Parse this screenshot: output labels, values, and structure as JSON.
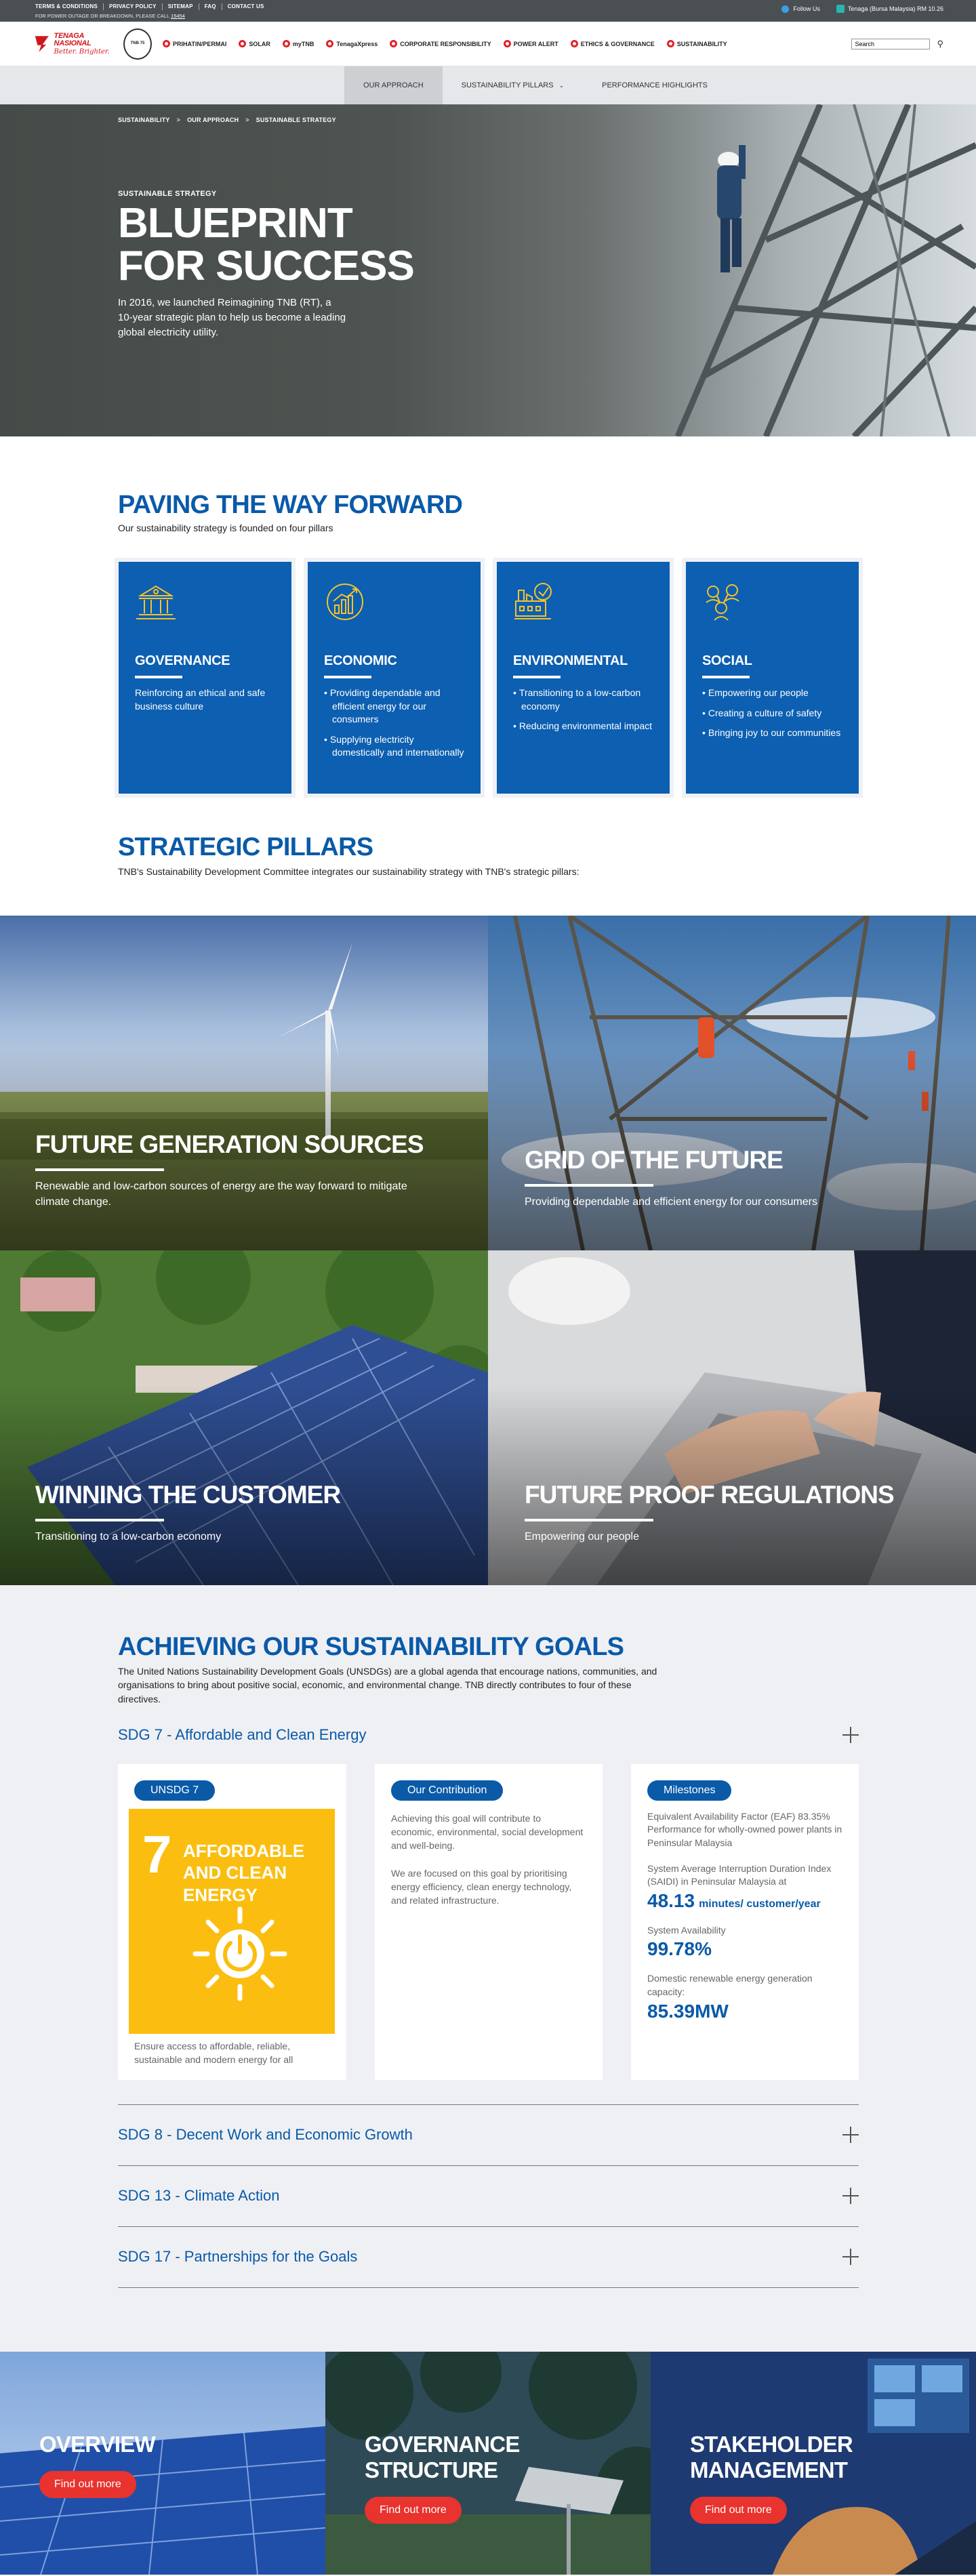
{
  "topbar": {
    "links": [
      "TERMS & CONDITIONS",
      "PRIVACY POLICY",
      "SITEMAP",
      "FAQ",
      "CONTACT US"
    ],
    "note_prefix": "FOR POWER OUTAGE OR BREAKDOWN, PLEASE CALL",
    "note_link": "15454",
    "follow": "Follow Us",
    "stock": "Tenaga (Bursa Malaysia) RM 10.26"
  },
  "header": {
    "logo_name": "TENAGA NASIONAL",
    "logo_tagline": "Better. Brighter.",
    "seal_text": "TNB 75",
    "nav": [
      "PRIHATIN/PERMAI",
      "SOLAR",
      "myTNB",
      "TenagaXpress",
      "CORPORATE RESPONSIBILITY",
      "POWER ALERT",
      "ETHICS & GOVERNANCE",
      "SUSTAINABILITY"
    ],
    "search_value": "Search",
    "search_icon": "search-icon"
  },
  "subnav": {
    "tabs": [
      "OUR APPROACH",
      "SUSTAINABILITY PILLARS",
      "PERFORMANCE HIGHLIGHTS"
    ]
  },
  "hero": {
    "crumbs": [
      "SUSTAINABILITY",
      "OUR APPROACH",
      "SUSTAINABLE STRATEGY"
    ],
    "kicker": "SUSTAINABLE STRATEGY",
    "title_line1": "BLUEPRINT",
    "title_line2": "FOR SUCCESS",
    "desc": "In 2016, we launched Reimagining TNB (RT), a 10-year strategic plan to help us become a leading global electricity utility."
  },
  "paving": {
    "title": "PAVING THE WAY FORWARD",
    "sub": "Our sustainability strategy is founded on four pillars",
    "cards": [
      {
        "icon": "governance-building-icon",
        "title": "GOVERNANCE",
        "text": "Reinforcing an ethical and safe business culture"
      },
      {
        "icon": "economic-chart-icon",
        "title": "ECONOMIC",
        "items": [
          "Providing dependable and efficient energy for our consumers",
          "Supplying electricity domestically and internationally"
        ]
      },
      {
        "icon": "environmental-factory-icon",
        "title": "ENVIRONMENTAL",
        "items": [
          "Transitioning to a low-carbon economy",
          "Reducing environmental impact"
        ]
      },
      {
        "icon": "social-people-icon",
        "title": "SOCIAL",
        "items": [
          "Empowering our people",
          "Creating a culture of safety",
          "Bringing joy to our communities"
        ]
      }
    ]
  },
  "strategic": {
    "title": "STRATEGIC PILLARS",
    "sub": "TNB's Sustainability Development Committee integrates our sustainability strategy with TNB's strategic pillars:",
    "tiles": [
      {
        "title": "FUTURE GENERATION SOURCES",
        "text": "Renewable and low-carbon sources of energy are the way forward to mitigate climate change."
      },
      {
        "title": "GRID OF THE FUTURE",
        "text": "Providing dependable and efficient energy for our consumers"
      },
      {
        "title": "WINNING THE CUSTOMER",
        "text": "Transitioning to a low-carbon economy"
      },
      {
        "title": "FUTURE PROOF REGULATIONS",
        "text": "Empowering our people"
      }
    ]
  },
  "sdg": {
    "title": "ACHIEVING OUR SUSTAINABILITY GOALS",
    "desc": "The United Nations Sustainability Development Goals (UNSDGs) are a global agenda that encourage nations, communities, and organisations to bring about positive social, economic, and environmental change. TNB directly contributes to four of these directives.",
    "open": {
      "label": "SDG 7 - Affordable and Clean Energy",
      "pill1": "UNSDG 7",
      "tile_num": "7",
      "tile_name": "AFFORDABLE AND CLEAN ENERGY",
      "tile_color": "#fbbe10",
      "caption": "Ensure access to affordable, reliable, sustainable and modern energy for all",
      "pill2": "Our Contribution",
      "contrib1": "Achieving this goal will contribute to economic, environmental, social development and well-being.",
      "contrib2": "We are focused on this goal by prioritising energy efficiency, clean energy technology, and related infrastructure.",
      "pill3": "Milestones",
      "m1": "Equivalent Availability Factor (EAF) 83.35% Performance for wholly-owned power plants in Peninsular Malaysia",
      "m2": "System Average Interruption Duration Index (SAIDI) in Peninsular Malaysia at",
      "m2_val": "48.13",
      "m2_unit": "minutes/ customer/year",
      "m3": "System Availability",
      "m3_val": "99.78%",
      "m4": "Domestic renewable energy generation capacity:",
      "m4_val": "85.39MW"
    },
    "closed": [
      "SDG 8 - Decent Work and Economic Growth",
      "SDG 13 - Climate Action",
      "SDG 17 - Partnerships for the Goals"
    ]
  },
  "bottom": {
    "cards": [
      {
        "title": "OVERVIEW",
        "button": "Find out more"
      },
      {
        "title": "GOVERNANCE STRUCTURE",
        "button": "Find out more"
      },
      {
        "title": "STAKEHOLDER MANAGEMENT",
        "button": "Find out more"
      }
    ]
  },
  "colors": {
    "brand_blue": "#0a5aa8",
    "card_blue": "#0c5fb1",
    "accent_red": "#e8332e",
    "sdg_yellow": "#fbbe10"
  }
}
